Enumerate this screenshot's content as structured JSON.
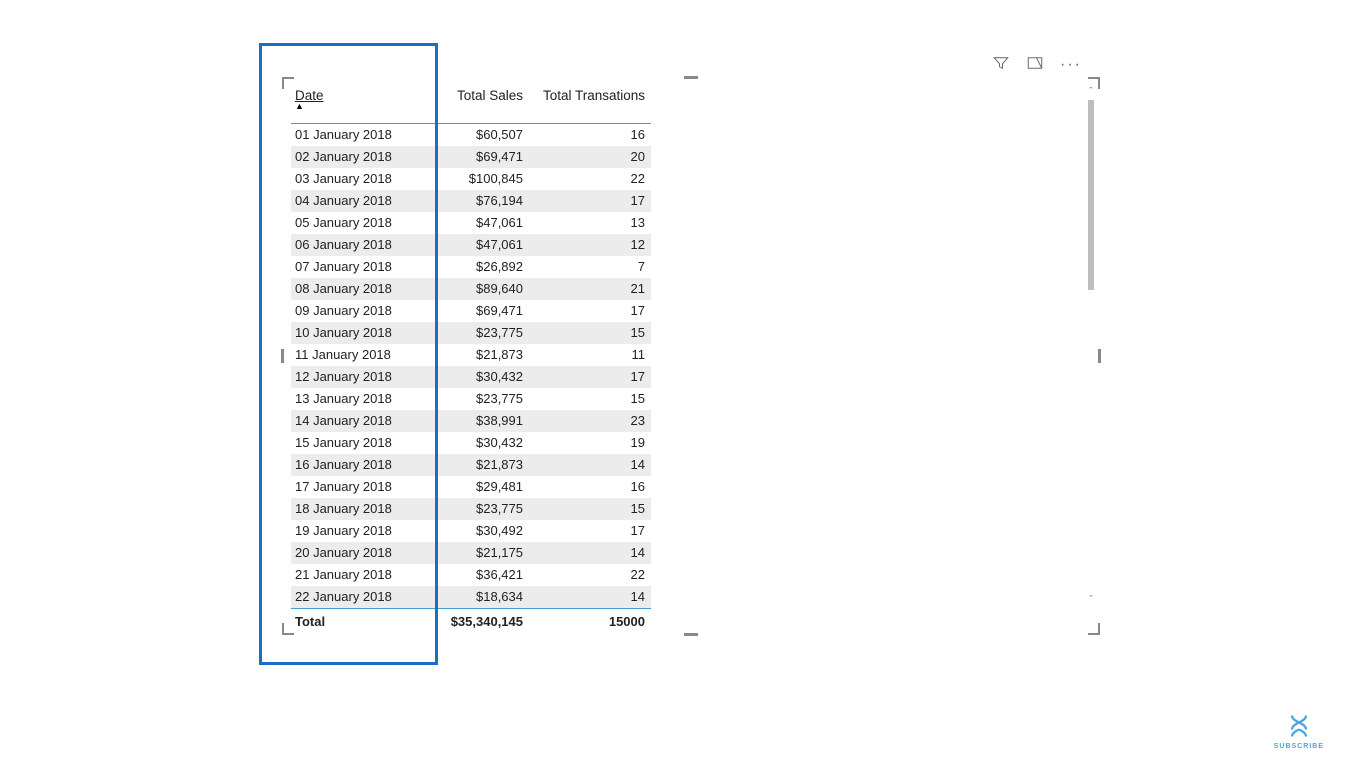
{
  "columns": {
    "date": "Date",
    "sales": "Total Sales",
    "trans": "Total Transations"
  },
  "rows": [
    {
      "date": "01 January 2018",
      "sales": "$60,507",
      "trans": "16"
    },
    {
      "date": "02 January 2018",
      "sales": "$69,471",
      "trans": "20"
    },
    {
      "date": "03 January 2018",
      "sales": "$100,845",
      "trans": "22"
    },
    {
      "date": "04 January 2018",
      "sales": "$76,194",
      "trans": "17"
    },
    {
      "date": "05 January 2018",
      "sales": "$47,061",
      "trans": "13"
    },
    {
      "date": "06 January 2018",
      "sales": "$47,061",
      "trans": "12"
    },
    {
      "date": "07 January 2018",
      "sales": "$26,892",
      "trans": "7"
    },
    {
      "date": "08 January 2018",
      "sales": "$89,640",
      "trans": "21"
    },
    {
      "date": "09 January 2018",
      "sales": "$69,471",
      "trans": "17"
    },
    {
      "date": "10 January 2018",
      "sales": "$23,775",
      "trans": "15"
    },
    {
      "date": "11 January 2018",
      "sales": "$21,873",
      "trans": "11"
    },
    {
      "date": "12 January 2018",
      "sales": "$30,432",
      "trans": "17"
    },
    {
      "date": "13 January 2018",
      "sales": "$23,775",
      "trans": "15"
    },
    {
      "date": "14 January 2018",
      "sales": "$38,991",
      "trans": "23"
    },
    {
      "date": "15 January 2018",
      "sales": "$30,432",
      "trans": "19"
    },
    {
      "date": "16 January 2018",
      "sales": "$21,873",
      "trans": "14"
    },
    {
      "date": "17 January 2018",
      "sales": "$29,481",
      "trans": "16"
    },
    {
      "date": "18 January 2018",
      "sales": "$23,775",
      "trans": "15"
    },
    {
      "date": "19 January 2018",
      "sales": "$30,492",
      "trans": "17"
    },
    {
      "date": "20 January 2018",
      "sales": "$21,175",
      "trans": "14"
    },
    {
      "date": "21 January 2018",
      "sales": "$36,421",
      "trans": "22"
    },
    {
      "date": "22 January 2018",
      "sales": "$18,634",
      "trans": "14"
    }
  ],
  "total": {
    "label": "Total",
    "sales": "$35,340,145",
    "trans": "15000"
  },
  "subscribe": "SUBSCRIBE"
}
